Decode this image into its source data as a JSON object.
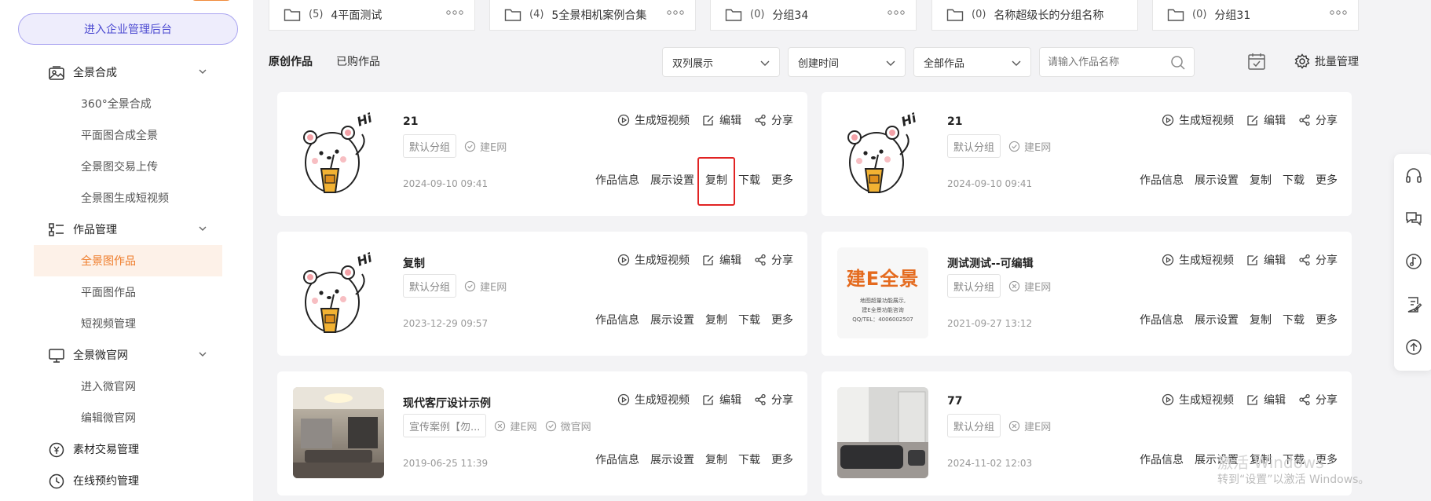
{
  "sidebar": {
    "admin_button": "进入企业管理后台",
    "groups": [
      {
        "label": "全景合成",
        "items": [
          "360°全景合成",
          "平面图合成全景",
          "全景图交易上传",
          "全景图生成短视频"
        ]
      },
      {
        "label": "作品管理",
        "items": [
          "全景图作品",
          "平面图作品",
          "短视频管理"
        ]
      },
      {
        "label": "全景微官网",
        "items": [
          "进入微官网",
          "编辑微官网"
        ]
      },
      {
        "label": "素材交易管理",
        "items": []
      },
      {
        "label": "在线预约管理",
        "items": []
      }
    ],
    "active_item": "全景图作品"
  },
  "folders": [
    {
      "count": "(5)",
      "name": "4平面测试"
    },
    {
      "count": "(4)",
      "name": "5全景相机案例合集"
    },
    {
      "count": "(0)",
      "name": "分组34"
    },
    {
      "count": "(0)",
      "name": "名称超级长的分组名称"
    },
    {
      "count": "(0)",
      "name": "分组31"
    }
  ],
  "folder_more": "ooo",
  "tabs": [
    "原创作品",
    "已购作品"
  ],
  "filters": {
    "view": "双列展示",
    "sort": "创建时间",
    "scope": "全部作品",
    "search_placeholder": "请输入作品名称",
    "batch": "批量管理"
  },
  "card_actions": {
    "top": [
      "生成短视频",
      "编辑",
      "分享"
    ],
    "bottom": [
      "作品信息",
      "展示设置",
      "复制",
      "下载",
      "更多"
    ]
  },
  "cards": [
    {
      "title": "21",
      "group": "默认分组",
      "sites": [
        {
          "name": "建E网",
          "status": "check"
        }
      ],
      "date": "2024-09-10 09:41",
      "thumb": "bear"
    },
    {
      "title": "21",
      "group": "默认分组",
      "sites": [
        {
          "name": "建E网",
          "status": "check"
        }
      ],
      "date": "2024-09-10 09:41",
      "thumb": "bear"
    },
    {
      "title": "复制",
      "group": "默认分组",
      "sites": [
        {
          "name": "建E网",
          "status": "check"
        }
      ],
      "date": "2023-12-29 09:57",
      "thumb": "bear"
    },
    {
      "title": "测试测试--可编辑",
      "group": "默认分组",
      "sites": [
        {
          "name": "建E网",
          "status": "cross"
        }
      ],
      "date": "2021-09-27 13:12",
      "thumb": "logo"
    },
    {
      "title": "现代客厅设计示例",
      "group": "宣传案例【勿...",
      "sites": [
        {
          "name": "建E网",
          "status": "cross"
        },
        {
          "name": "微官网",
          "status": "check"
        }
      ],
      "date": "2019-06-25 11:39",
      "thumb": "room1"
    },
    {
      "title": "77",
      "group": "默认分组",
      "sites": [
        {
          "name": "建E网",
          "status": "cross"
        }
      ],
      "date": "2024-11-02 12:03",
      "thumb": "room2"
    }
  ],
  "logo_thumb": {
    "brand": "建E全景",
    "line1": "地图超量功能展示,",
    "line2": "建E全景功能咨询",
    "line3": "QQ/TEL：4006002507"
  },
  "bear_text": "Hi",
  "watermark": {
    "line1": "激活 Windows",
    "line2": "转到“设置”以激活 Windows。"
  },
  "colors": {
    "accent": "#ef7d2b",
    "primary_purple": "#4c4ad1",
    "highlight_red": "#e12323"
  }
}
